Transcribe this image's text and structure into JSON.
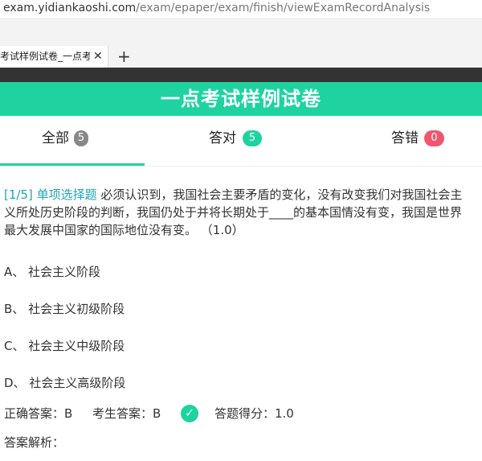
{
  "browser": {
    "url_domain": "exam.yidiankaoshi.com",
    "url_path": "/exam/epaper/exam/finish/viewExamRecordAnalysis",
    "tab_title": "考试样例试卷_一点考试",
    "tab_close": "✕",
    "new_tab": "+"
  },
  "header": {
    "title": "一点考试样例试卷"
  },
  "filter_tabs": [
    {
      "label": "全部",
      "count": "5",
      "active": true,
      "badge_color": "#888888"
    },
    {
      "label": "答对",
      "count": "5",
      "active": false,
      "badge_color": "#1fd3a0"
    },
    {
      "label": "答错",
      "count": "0",
      "active": false,
      "badge_color": "#f0566e"
    }
  ],
  "question": {
    "index": "[1/5]",
    "type": "单项选择题",
    "text_line1": " 必须认识到，我国社会主要矛盾的变化，没有改变我们对我国社会主",
    "text_line2": "义所处历史阶段的判断，我国仍处于并将长期处于____的基本国情没有变，我国是世界",
    "text_line3": "最大发展中国家的国际地位没有变。 （1.0）",
    "options": [
      {
        "key": "A、",
        "text": "社会主义阶段"
      },
      {
        "key": "B、",
        "text": "社会主义初级阶段"
      },
      {
        "key": "C、",
        "text": "社会主义中级阶段"
      },
      {
        "key": "D、",
        "text": "社会主义高级阶段"
      }
    ],
    "correct_answer": "正确答案：B",
    "student_answer": "考生答案：B",
    "check_icon": "✓",
    "score": "答题得分：1.0",
    "analysis_label": "答案解析："
  }
}
